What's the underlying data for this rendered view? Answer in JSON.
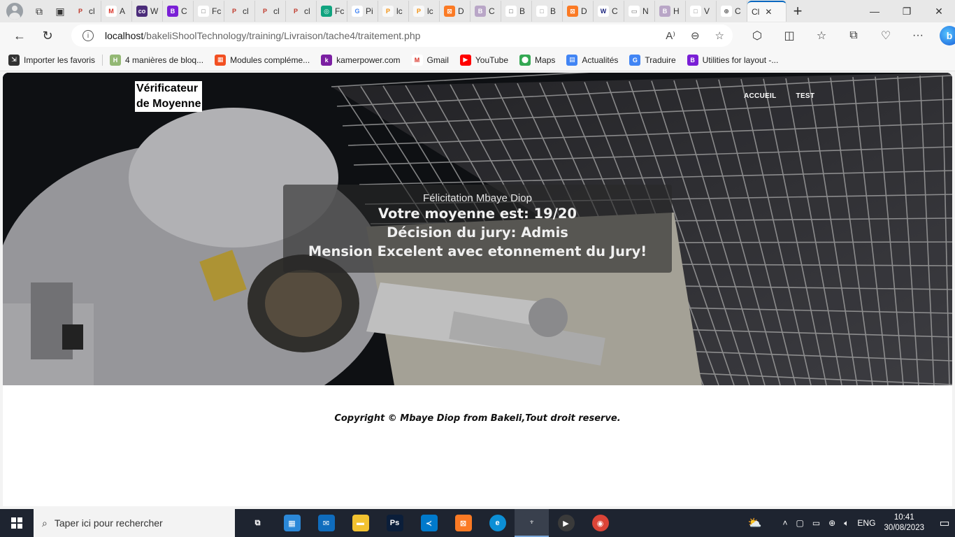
{
  "browser": {
    "tabs": [
      {
        "short": "cl",
        "color": "#e8e8e8",
        "glyph": "PDF",
        "fg": "#c0392b"
      },
      {
        "short": "A",
        "color": "#ffffff",
        "glyph": "M",
        "fg": "#d93025"
      },
      {
        "short": "W",
        "color": "#4b2c7a",
        "glyph": "co",
        "fg": "#ffffff"
      },
      {
        "short": "C",
        "color": "#7a1fd6",
        "glyph": "B",
        "fg": "#ffffff"
      },
      {
        "short": "Fc",
        "color": "#ffffff",
        "glyph": "□",
        "fg": "#666666"
      },
      {
        "short": "cl",
        "color": "#e8e8e8",
        "glyph": "PDF",
        "fg": "#c0392b"
      },
      {
        "short": "cl",
        "color": "#e8e8e8",
        "glyph": "PDF",
        "fg": "#c0392b"
      },
      {
        "short": "cl",
        "color": "#e8e8e8",
        "glyph": "PDF",
        "fg": "#c0392b"
      },
      {
        "short": "Fc",
        "color": "#10a37f",
        "glyph": "◎",
        "fg": "#ffffff"
      },
      {
        "short": "Pi",
        "color": "#ffffff",
        "glyph": "G",
        "fg": "#4285f4"
      },
      {
        "short": "lc",
        "color": "#f8f8f8",
        "glyph": "PMA",
        "fg": "#f29111"
      },
      {
        "short": "lc",
        "color": "#f8f8f8",
        "glyph": "PMA",
        "fg": "#f29111"
      },
      {
        "short": "D",
        "color": "#fb7a24",
        "glyph": "⊠",
        "fg": "#ffffff"
      },
      {
        "short": "C",
        "color": "#b9a6c7",
        "glyph": "B",
        "fg": "#ffffff"
      },
      {
        "short": "B",
        "color": "#ffffff",
        "glyph": "□",
        "fg": "#444444"
      },
      {
        "short": "B",
        "color": "#ffffff",
        "glyph": "□",
        "fg": "#888888"
      },
      {
        "short": "D",
        "color": "#fb7a24",
        "glyph": "⊠",
        "fg": "#ffffff"
      },
      {
        "short": "C",
        "color": "#ffffff",
        "glyph": "W",
        "fg": "#1a237e"
      },
      {
        "short": "N",
        "color": "#ffffff",
        "glyph": "▭",
        "fg": "#666666"
      },
      {
        "short": "H",
        "color": "#b9a6c7",
        "glyph": "B",
        "fg": "#ffffff"
      },
      {
        "short": "V",
        "color": "#ffffff",
        "glyph": "□",
        "fg": "#888888"
      },
      {
        "short": "C",
        "color": "#ffffff",
        "glyph": "⊕",
        "fg": "#555555"
      }
    ],
    "active_tab": {
      "short": "Cl",
      "close": "✕"
    },
    "new_tab": "+",
    "url_host": "localhost",
    "url_path": "/bakeliShoolTechnology/training/Livraison/tache4/traitement.php",
    "bing_label": "b",
    "favorites": [
      {
        "label": "Importer les favoris",
        "icon": "import-icon",
        "color": "#333333",
        "glyph": "⇲"
      },
      {
        "label": "4 manières de bloq...",
        "icon": "wikihow-icon",
        "color": "#93b874",
        "glyph": "H"
      },
      {
        "label": "Modules compléme...",
        "icon": "microsoft-icon",
        "color": "#f25022",
        "glyph": "▦"
      },
      {
        "label": "kamerpower.com",
        "icon": "kamerpower-icon",
        "color": "#7b1fa2",
        "glyph": "k"
      },
      {
        "label": "Gmail",
        "icon": "gmail-icon",
        "color": "#ffffff",
        "glyph": "M"
      },
      {
        "label": "YouTube",
        "icon": "youtube-icon",
        "color": "#ff0000",
        "glyph": "▶"
      },
      {
        "label": "Maps",
        "icon": "maps-icon",
        "color": "#34a853",
        "glyph": "⬤"
      },
      {
        "label": "Actualités",
        "icon": "news-icon",
        "color": "#4285f4",
        "glyph": "▤"
      },
      {
        "label": "Traduire",
        "icon": "translate-icon",
        "color": "#4285f4",
        "glyph": "G"
      },
      {
        "label": "Utilities for layout -...",
        "icon": "bootstrap-icon",
        "color": "#7a1fd6",
        "glyph": "B"
      }
    ]
  },
  "page": {
    "brand_line1": "Vérificateur",
    "brand_line2": "de Moyenne",
    "nav": [
      "ACCUEIL",
      "TEST"
    ],
    "greeting": "Félicitation Mbaye Diop",
    "average": "Votre moyenne est: 19/20",
    "decision": "Décision du jury: Admis",
    "mention": "Mension Excelent avec etonnement du Jury!",
    "copyright": "Copyright © Mbaye Diop from Bakeli,Tout droit reserve."
  },
  "taskbar": {
    "search_placeholder": "Taper ici pour rechercher",
    "apps": [
      {
        "name": "task-view",
        "color": "transparent",
        "glyph": "⧉"
      },
      {
        "name": "microsoft-store",
        "color": "#2b88d8",
        "glyph": "▦"
      },
      {
        "name": "mail",
        "color": "#0f6cbd",
        "glyph": "✉"
      },
      {
        "name": "file-explorer",
        "color": "#f2c230",
        "glyph": "▬"
      },
      {
        "name": "photoshop",
        "color": "#0b1e3a",
        "glyph": "Ps"
      },
      {
        "name": "vscode",
        "color": "#007acc",
        "glyph": "≺"
      },
      {
        "name": "xampp",
        "color": "#fb7a24",
        "glyph": "⊠"
      },
      {
        "name": "edge",
        "color": "#0c8fd6",
        "glyph": "e"
      },
      {
        "name": "git-client",
        "color": "#39404d",
        "glyph": "♆"
      },
      {
        "name": "media-player",
        "color": "#3a3a3a",
        "glyph": "▶"
      },
      {
        "name": "chrome",
        "color": "#db4437",
        "glyph": "◉"
      }
    ],
    "language": "ENG",
    "time": "10:41",
    "date": "30/08/2023"
  }
}
